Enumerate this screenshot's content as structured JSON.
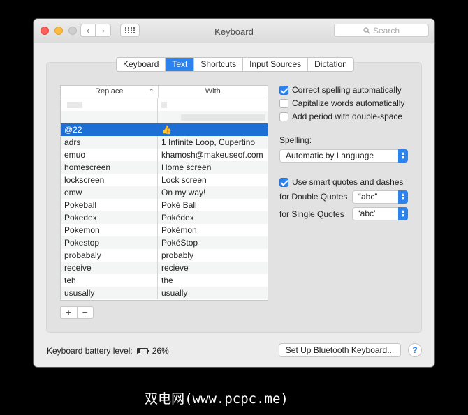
{
  "window": {
    "title": "Keyboard"
  },
  "search": {
    "placeholder": "Search"
  },
  "tabs": [
    {
      "label": "Keyboard",
      "active": false
    },
    {
      "label": "Text",
      "active": true
    },
    {
      "label": "Shortcuts",
      "active": false
    },
    {
      "label": "Input Sources",
      "active": false
    },
    {
      "label": "Dictation",
      "active": false
    }
  ],
  "table": {
    "headers": {
      "replace": "Replace",
      "with": "With"
    },
    "sorted_column": "replace",
    "sort_direction": "ascending",
    "selected_row": 2,
    "rows": [
      {
        "replace": "",
        "with": "",
        "blurred": true
      },
      {
        "replace": "",
        "with": "",
        "blurred": true
      },
      {
        "replace": "@22",
        "with": "👍"
      },
      {
        "replace": "adrs",
        "with": "1 Infinite Loop, Cupertino"
      },
      {
        "replace": "emuo",
        "with": "khamosh@makeuseof.com"
      },
      {
        "replace": "homescreen",
        "with": "Home screen"
      },
      {
        "replace": "lockscreen",
        "with": "Lock screen"
      },
      {
        "replace": "omw",
        "with": "On my way!"
      },
      {
        "replace": "Pokeball",
        "with": "Poké Ball"
      },
      {
        "replace": "Pokedex",
        "with": "Pokédex"
      },
      {
        "replace": "Pokemon",
        "with": "Pokémon"
      },
      {
        "replace": "Pokestop",
        "with": "PokéStop"
      },
      {
        "replace": "probabaly",
        "with": "probably"
      },
      {
        "replace": "receive",
        "with": "recieve"
      },
      {
        "replace": "teh",
        "with": "the"
      },
      {
        "replace": "ususally",
        "with": "usually"
      }
    ],
    "add_label": "+",
    "remove_label": "−"
  },
  "options": {
    "correct_spelling": {
      "label": "Correct spelling automatically",
      "checked": true
    },
    "capitalize": {
      "label": "Capitalize words automatically",
      "checked": false
    },
    "period": {
      "label": "Add period with double-space",
      "checked": false
    },
    "spelling_label": "Spelling:",
    "spelling_value": "Automatic by Language",
    "smart_quotes": {
      "label": "Use smart quotes and dashes",
      "checked": true
    },
    "double_quotes_label": "for Double Quotes",
    "double_quotes_value": "“abc”",
    "single_quotes_label": "for Single Quotes",
    "single_quotes_value": "‘abc’"
  },
  "footer": {
    "battery_label": "Keyboard battery level:",
    "battery_percent": "26%",
    "battery_level": 0.26,
    "bluetooth_button": "Set Up Bluetooth Keyboard...",
    "help": "?"
  },
  "watermark": "双电网(www.pcpc.me)",
  "colors": {
    "accent": "#2d83ed",
    "selection": "#1d6fd6",
    "background": "#000000"
  },
  "icons": [
    "back-arrow-icon",
    "forward-arrow-icon",
    "grid-icon",
    "search-icon",
    "battery-icon",
    "help-icon"
  ]
}
